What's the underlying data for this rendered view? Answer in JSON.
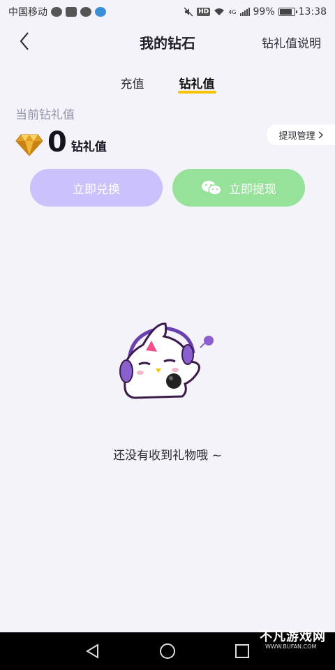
{
  "status_bar": {
    "carrier": "中国移动",
    "network": "4G",
    "battery": "99%",
    "time": "13:38",
    "hd": "HD"
  },
  "header": {
    "title": "我的钻石",
    "right_link": "钻礼值说明"
  },
  "tabs": [
    {
      "label": "充值",
      "active": false
    },
    {
      "label": "钻礼值",
      "active": true
    }
  ],
  "balance": {
    "label": "当前钻礼值",
    "value": "0",
    "unit": "钻礼值",
    "withdraw_management": "提现管理"
  },
  "actions": {
    "exchange_label": "立即兑换",
    "withdraw_label": "立即提现"
  },
  "empty_state": {
    "message": "还没有收到礼物哦 ~"
  },
  "watermark": {
    "text": "不凡游戏网",
    "url": "WWW.BUFAN.COM"
  },
  "colors": {
    "tab_underline": "#f5c400",
    "exchange_button": "#cbc2fb",
    "withdraw_button": "#96e29a",
    "background": "#f4f3fa"
  }
}
